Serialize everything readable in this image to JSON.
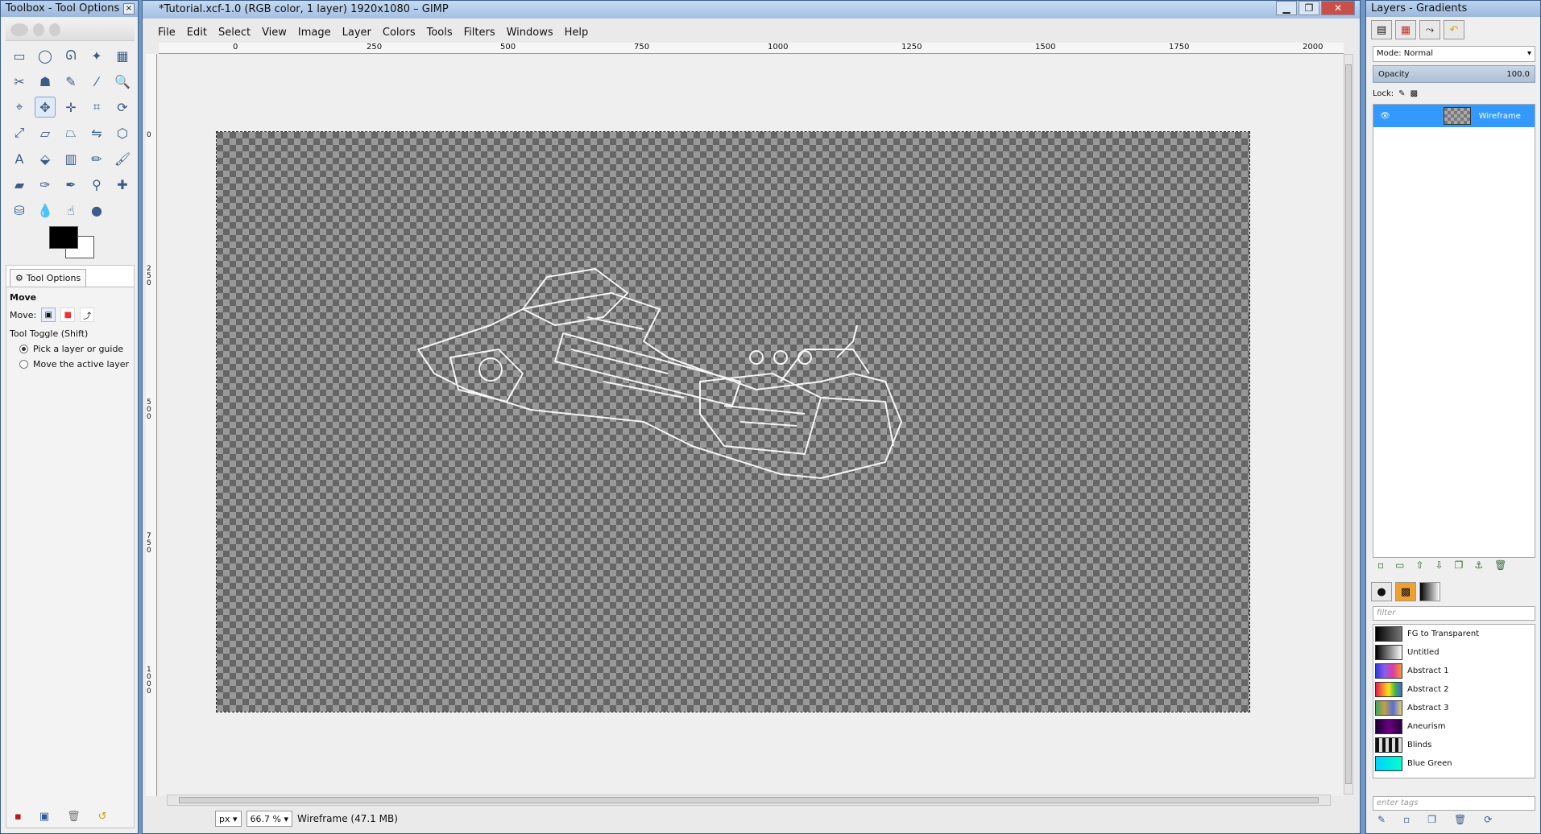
{
  "toolbox": {
    "title": "Toolbox - Tool Options",
    "close": "×",
    "tools": [
      {
        "name": "rect-select-icon",
        "glyph": "▭"
      },
      {
        "name": "ellipse-select-icon",
        "glyph": "◯"
      },
      {
        "name": "free-select-icon",
        "glyph": "ᘏ"
      },
      {
        "name": "fuzzy-select-icon",
        "glyph": "✦"
      },
      {
        "name": "color-select-icon",
        "glyph": "▦"
      },
      {
        "name": "scissors-icon",
        "glyph": "✂"
      },
      {
        "name": "foreground-select-icon",
        "glyph": "☗"
      },
      {
        "name": "paths-icon",
        "glyph": "✎"
      },
      {
        "name": "color-picker-icon",
        "glyph": "⁄"
      },
      {
        "name": "zoom-icon",
        "glyph": "🔍"
      },
      {
        "name": "measure-icon",
        "glyph": "⌖"
      },
      {
        "name": "move-icon",
        "glyph": "✥",
        "active": true
      },
      {
        "name": "align-icon",
        "glyph": "✛"
      },
      {
        "name": "crop-icon",
        "glyph": "⌗"
      },
      {
        "name": "rotate-icon",
        "glyph": "⟳"
      },
      {
        "name": "scale-icon",
        "glyph": "⤢"
      },
      {
        "name": "shear-icon",
        "glyph": "▱"
      },
      {
        "name": "perspective-icon",
        "glyph": "⏢"
      },
      {
        "name": "flip-icon",
        "glyph": "⇋"
      },
      {
        "name": "cage-icon",
        "glyph": "⬡"
      },
      {
        "name": "text-icon",
        "glyph": "A"
      },
      {
        "name": "bucket-fill-icon",
        "glyph": "⬙"
      },
      {
        "name": "blend-icon",
        "glyph": "▥"
      },
      {
        "name": "pencil-icon",
        "glyph": "✏"
      },
      {
        "name": "paintbrush-icon",
        "glyph": "🖌"
      },
      {
        "name": "eraser-icon",
        "glyph": "▰"
      },
      {
        "name": "airbrush-icon",
        "glyph": "✑"
      },
      {
        "name": "ink-icon",
        "glyph": "✒"
      },
      {
        "name": "clone-icon",
        "glyph": "⚲"
      },
      {
        "name": "heal-icon",
        "glyph": "✚"
      },
      {
        "name": "perspective-clone-icon",
        "glyph": "⛁"
      },
      {
        "name": "blur-icon",
        "glyph": "💧"
      },
      {
        "name": "smudge-icon",
        "glyph": "☝"
      },
      {
        "name": "dodge-burn-icon",
        "glyph": "●"
      }
    ],
    "options_tab": "Tool Options",
    "tool_name": "Move",
    "move_label": "Move:",
    "toggle_label": "Tool Toggle  (Shift)",
    "radio1": "Pick a layer or guide",
    "radio2": "Move the active layer"
  },
  "image_window": {
    "title": "*Tutorial.xcf-1.0 (RGB color, 1 layer) 1920x1080 – GIMP",
    "menus": [
      "File",
      "Edit",
      "Select",
      "View",
      "Image",
      "Layer",
      "Colors",
      "Tools",
      "Filters",
      "Windows",
      "Help"
    ],
    "ruler_labels": [
      "0",
      "250",
      "500",
      "750",
      "1000",
      "1250",
      "1500",
      "1750",
      "2000"
    ],
    "vruler_labels": [
      "0",
      "250",
      "500",
      "750",
      "1000"
    ],
    "unit": "px",
    "zoom": "66.7 %",
    "status": "Wireframe (47.1 MB)"
  },
  "dock": {
    "title": "Layers - Gradients",
    "mode_label": "Mode: Normal",
    "opacity_label": "Opacity",
    "opacity_value": "100.0",
    "lock_label": "Lock:",
    "layer_name": "Wireframe",
    "filter_placeholder": "filter",
    "tags_placeholder": "enter tags",
    "gradients": [
      {
        "name": "FG to Transparent",
        "swatch": "linear-gradient(90deg,#000,#777)"
      },
      {
        "name": "Untitled",
        "swatch": "linear-gradient(90deg,#000,#fff)"
      },
      {
        "name": "Abstract 1",
        "swatch": "linear-gradient(90deg,#2b3bd8,#8a5cf0,#e03ca0,#f29a2c)"
      },
      {
        "name": "Abstract 2",
        "swatch": "linear-gradient(90deg,#e6194b,#f58231,#ffe119,#3cb44b,#4363d8)"
      },
      {
        "name": "Abstract 3",
        "swatch": "linear-gradient(90deg,#3ea55d,#c2a04a,#5a6dd8,#e3d46b)"
      },
      {
        "name": "Aneurism",
        "swatch": "linear-gradient(90deg,#1a0033,#6a0080,#2a0040)"
      },
      {
        "name": "Blinds",
        "swatch": "repeating-linear-gradient(90deg,#111 0 4px,#ddd 4px 8px)"
      },
      {
        "name": "Blue Green",
        "swatch": "linear-gradient(90deg,#00d2ff,#00ffcc)"
      }
    ]
  }
}
